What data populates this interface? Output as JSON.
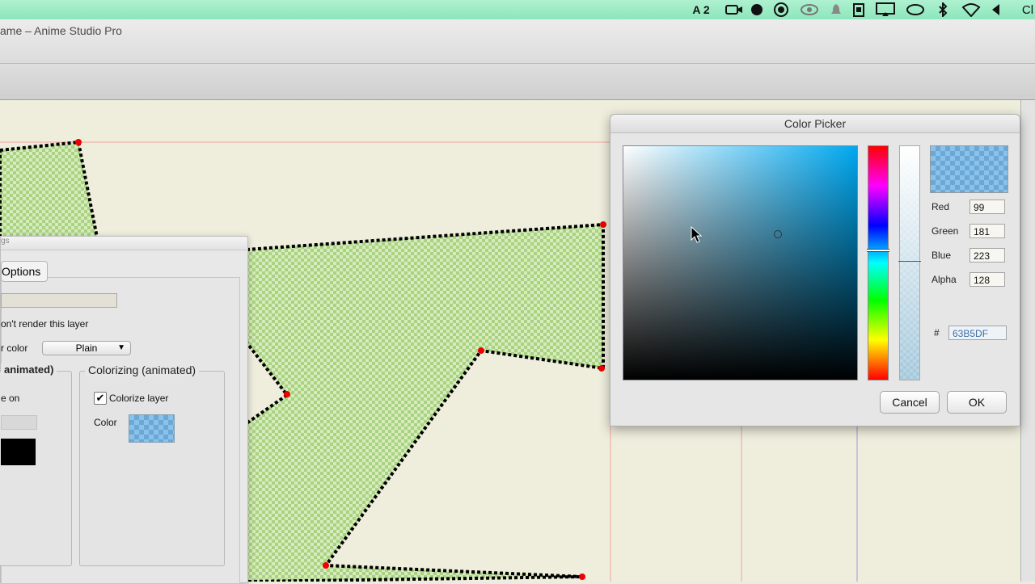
{
  "menubar": {
    "input_indicator": "A 2",
    "right_edge_text": "Cl"
  },
  "window": {
    "title": "ame – Anime Studio Pro"
  },
  "layer_dialog": {
    "header": "gs",
    "tab_label": "Options",
    "dont_render_label": "on't render this layer",
    "color_label": "r color",
    "color_select": "Plain",
    "left_group_title": "animated)",
    "left_group_text": "e on",
    "colorize_group_title": "Colorizing (animated)",
    "colorize_checkbox_label": "Colorize layer",
    "colorize_color_label": "Color"
  },
  "color_picker": {
    "title": "Color Picker",
    "red_label": "Red",
    "red_value": "99",
    "green_label": "Green",
    "green_value": "181",
    "blue_label": "Blue",
    "blue_value": "223",
    "alpha_label": "Alpha",
    "alpha_value": "128",
    "hex_label": "#",
    "hex_value": "63B5DF",
    "cancel_label": "Cancel",
    "ok_label": "OK",
    "selected_color": "#63B5DF"
  },
  "colors": {
    "menubar": "#9eeecb",
    "shape_fill": "#c4e0a0",
    "guide_red": "#f08a8a"
  },
  "icons": [
    "input-indicator-icon",
    "facetime-icon",
    "record-icon",
    "screen-icon",
    "sync-icon",
    "notification-icon",
    "clipboard-icon",
    "display-icon",
    "chat-icon",
    "bluetooth-icon",
    "wifi-icon",
    "volume-icon"
  ]
}
